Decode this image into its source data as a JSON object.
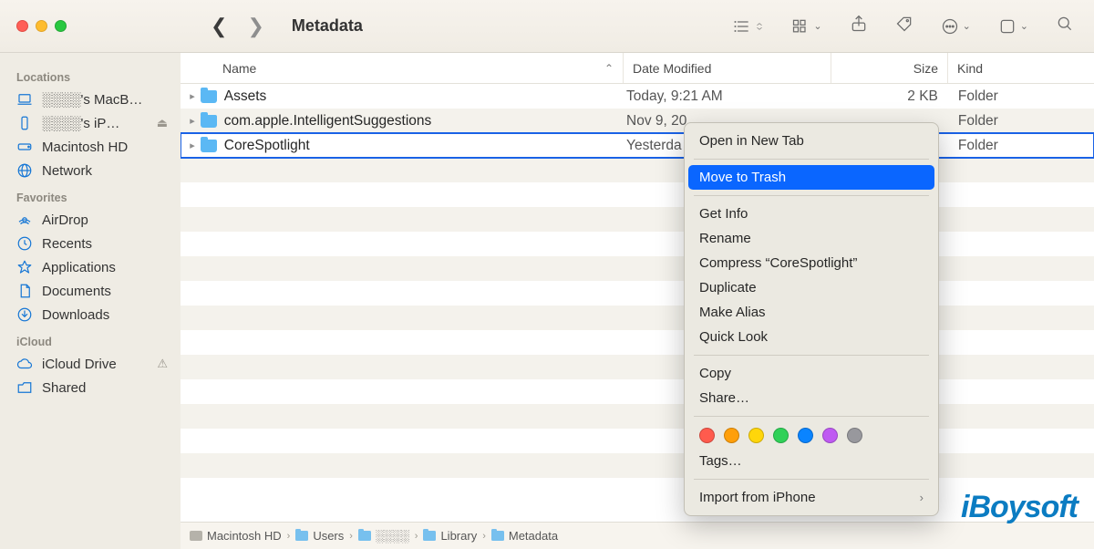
{
  "window": {
    "title": "Metadata"
  },
  "sidebar": {
    "sections": [
      {
        "label": "Locations",
        "items": [
          {
            "label": "░░░░'s MacB…",
            "icon": "laptop"
          },
          {
            "label": "░░░░'s iP…",
            "icon": "phone",
            "eject": true
          },
          {
            "label": "Macintosh HD",
            "icon": "disk"
          },
          {
            "label": "Network",
            "icon": "globe"
          }
        ]
      },
      {
        "label": "Favorites",
        "items": [
          {
            "label": "AirDrop",
            "icon": "airdrop"
          },
          {
            "label": "Recents",
            "icon": "clock"
          },
          {
            "label": "Applications",
            "icon": "apps"
          },
          {
            "label": "Documents",
            "icon": "doc"
          },
          {
            "label": "Downloads",
            "icon": "down"
          }
        ]
      },
      {
        "label": "iCloud",
        "items": [
          {
            "label": "iCloud Drive",
            "icon": "cloud",
            "warn": true
          },
          {
            "label": "Shared",
            "icon": "sharedfolder"
          }
        ]
      }
    ]
  },
  "columns": {
    "name": "Name",
    "date": "Date Modified",
    "size": "Size",
    "kind": "Kind"
  },
  "rows": [
    {
      "name": "Assets",
      "date": "Today, 9:21 AM",
      "size": "2 KB",
      "kind": "Folder"
    },
    {
      "name": "com.apple.IntelligentSuggestions",
      "date": "Nov 9, 20",
      "size": "",
      "kind": "Folder"
    },
    {
      "name": "CoreSpotlight",
      "date": "Yesterda",
      "size": "",
      "kind": "Folder",
      "selected": true
    }
  ],
  "context_menu": {
    "items": [
      {
        "label": "Open in New Tab"
      },
      {
        "divider": true
      },
      {
        "label": "Move to Trash",
        "highlight": true
      },
      {
        "divider": true
      },
      {
        "label": "Get Info"
      },
      {
        "label": "Rename"
      },
      {
        "label": "Compress “CoreSpotlight”"
      },
      {
        "label": "Duplicate"
      },
      {
        "label": "Make Alias"
      },
      {
        "label": "Quick Look"
      },
      {
        "divider": true
      },
      {
        "label": "Copy"
      },
      {
        "label": "Share…"
      },
      {
        "divider": true
      },
      {
        "tags": [
          "#ff5b4d",
          "#ff9f0a",
          "#ffd60a",
          "#30d158",
          "#0a84ff",
          "#bf5af2",
          "#98989d"
        ]
      },
      {
        "label": "Tags…"
      },
      {
        "divider": true
      },
      {
        "label": "Import from iPhone",
        "submenu": true
      }
    ]
  },
  "pathbar": [
    {
      "label": "Macintosh HD",
      "icon": "disk"
    },
    {
      "label": "Users",
      "icon": "folder"
    },
    {
      "label": "░░░░",
      "icon": "folder"
    },
    {
      "label": "Library",
      "icon": "folder"
    },
    {
      "label": "Metadata",
      "icon": "folder"
    }
  ],
  "watermark": "iBoysoft"
}
